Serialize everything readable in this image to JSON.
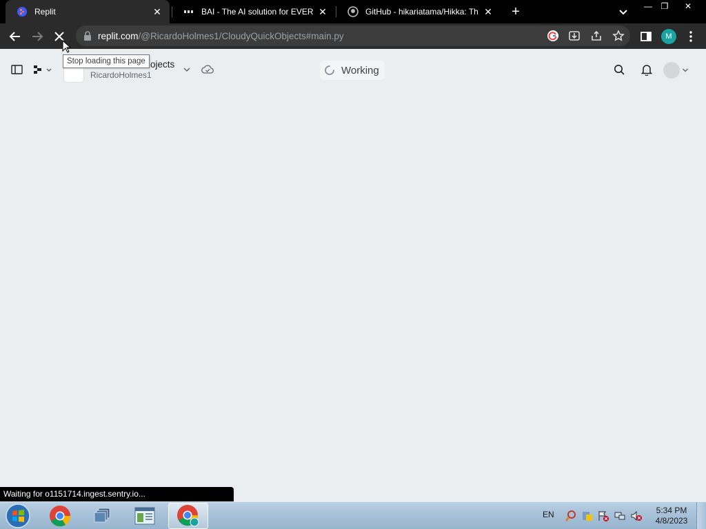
{
  "browser": {
    "tabs": [
      {
        "title": "Replit",
        "close": "✕"
      },
      {
        "title": "BAI - The AI solution for EVERYONE",
        "close": "✕"
      },
      {
        "title": "GitHub - hikariatama/Hikka: The",
        "close": "✕"
      }
    ],
    "new_tab": "+",
    "window_controls": {
      "minimize": "—",
      "restore": "❐",
      "close": "✕"
    },
    "url_host": "replit.com",
    "url_path": "/@RicardoHolmes1/CloudyQuickObjects#main.py",
    "profile_initial": "M",
    "tooltip": "Stop loading this page",
    "status_text": "Waiting for o1151714.ingest.sentry.io..."
  },
  "replit": {
    "repl_name": "CloudyQuickObjects",
    "repl_name_visible": "ojects",
    "owner": "RicardoHolmes1",
    "status": "Working"
  },
  "taskbar": {
    "language": "EN",
    "time": "5:34 PM",
    "date": "4/8/2023"
  },
  "colors": {
    "tab_strip": "#000000",
    "toolbar": "#2b2b2b",
    "omnibox": "#3c3c3c",
    "profile": "#1aa3a3",
    "page_bg": "#ebeef0"
  }
}
